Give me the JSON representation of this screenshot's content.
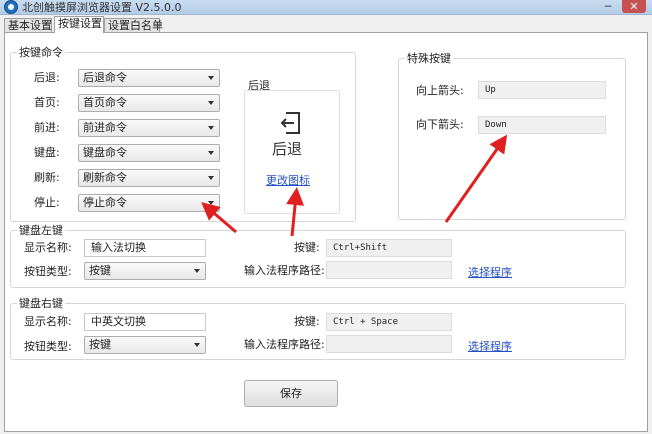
{
  "window": {
    "title": "北创触摸屏浏览器设置 V2.5.0.0",
    "minimize": "─",
    "close": "✕"
  },
  "tabs": [
    {
      "label": "基本设置"
    },
    {
      "label": "按键设置",
      "active": true
    },
    {
      "label": "设置白名单"
    }
  ],
  "key_commands": {
    "legend": "按键命令",
    "rows": [
      {
        "label": "后退:",
        "value": "后退命令"
      },
      {
        "label": "首页:",
        "value": "首页命令"
      },
      {
        "label": "前进:",
        "value": "前进命令"
      },
      {
        "label": "键盘:",
        "value": "键盘命令"
      },
      {
        "label": "刷新:",
        "value": "刷新命令"
      },
      {
        "label": "停止:",
        "value": "停止命令"
      }
    ]
  },
  "preview": {
    "legend": "后退",
    "caption": "后退",
    "change_icon": "更改图标"
  },
  "special_keys": {
    "legend": "特殊按键",
    "up_label": "向上箭头:",
    "up_value": "Up",
    "down_label": "向下箭头:",
    "down_value": "Down"
  },
  "keyboard_left": {
    "legend": "键盘左键",
    "display_name_label": "显示名称:",
    "display_name_value": "输入法切换",
    "button_type_label": "按钮类型:",
    "button_type_value": "按键",
    "key_label": "按键:",
    "key_value": "Ctrl+Shift",
    "path_label": "输入法程序路径:",
    "path_value": "",
    "select_program": "选择程序"
  },
  "keyboard_right": {
    "legend": "键盘右键",
    "display_name_label": "显示名称:",
    "display_name_value": "中英文切换",
    "button_type_label": "按钮类型:",
    "button_type_value": "按键",
    "key_label": "按键:",
    "key_value": "Ctrl + Space",
    "path_label": "输入法程序路径:",
    "path_value": "",
    "select_program": "选择程序"
  },
  "save_label": "保存",
  "colors": {
    "accent_link": "#2451c4",
    "annotation_arrow": "#e02020",
    "close_button": "#c75050"
  }
}
